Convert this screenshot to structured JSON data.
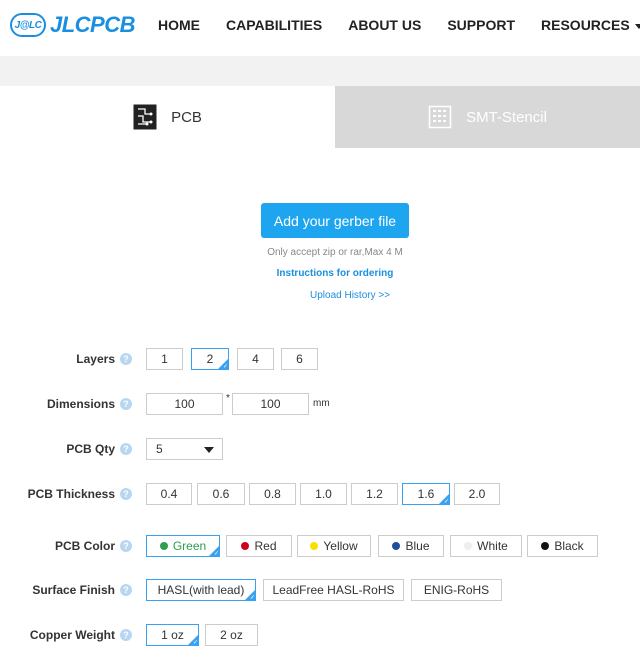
{
  "header": {
    "logo_badge": "J@LC",
    "logo_text": "JLCPCB",
    "nav": [
      "HOME",
      "CAPABILITIES",
      "ABOUT US",
      "SUPPORT",
      "RESOURCES"
    ]
  },
  "tabs": [
    {
      "label": "PCB",
      "icon": "pcb-board-icon",
      "active": true
    },
    {
      "label": "SMT-Stencil",
      "icon": "stencil-icon",
      "active": false
    }
  ],
  "upload": {
    "button": "Add your gerber file",
    "note": "Only accept zip or rar,Max 4 M",
    "instructions": "Instructions for ordering",
    "history": "Upload History >>"
  },
  "form": {
    "layers": {
      "label": "Layers",
      "options": [
        "1",
        "2",
        "4",
        "6"
      ],
      "selected": "2"
    },
    "dimensions": {
      "label": "Dimensions",
      "width": "100",
      "separator": "*",
      "height": "100",
      "unit": "mm"
    },
    "qty": {
      "label": "PCB Qty",
      "value": "5"
    },
    "thickness": {
      "label": "PCB Thickness",
      "options": [
        "0.4",
        "0.6",
        "0.8",
        "1.0",
        "1.2",
        "1.6",
        "2.0"
      ],
      "selected": "1.6"
    },
    "color": {
      "label": "PCB Color",
      "options": [
        {
          "name": "Green",
          "dot": "#2e9e4f",
          "text": "#2e9e4f"
        },
        {
          "name": "Red",
          "dot": "#d0021b",
          "text": "#333333"
        },
        {
          "name": "Yellow",
          "dot": "#f8e000",
          "text": "#333333"
        },
        {
          "name": "Blue",
          "dot": "#1f4e9c",
          "text": "#333333"
        },
        {
          "name": "White",
          "dot": "#eeeeee",
          "text": "#333333"
        },
        {
          "name": "Black",
          "dot": "#111111",
          "text": "#333333"
        }
      ],
      "selected": "Green"
    },
    "finish": {
      "label": "Surface Finish",
      "options": [
        "HASL(with lead)",
        "LeadFree HASL-RoHS",
        "ENIG-RoHS"
      ],
      "selected": "HASL(with lead)"
    },
    "copper": {
      "label": "Copper Weight",
      "options": [
        "1 oz",
        "2 oz"
      ],
      "selected": "1 oz"
    },
    "help_glyph": "?"
  },
  "colors": {
    "accent": "#1ea5f0",
    "link": "#1a8fe0",
    "tab_inactive": "#d8d8d8"
  }
}
